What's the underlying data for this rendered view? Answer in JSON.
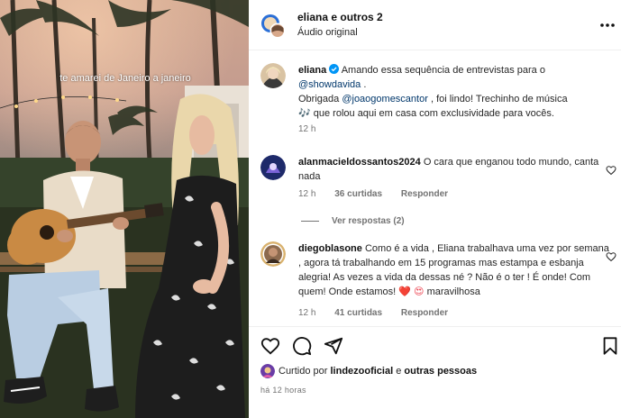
{
  "video": {
    "caption": "te amarei de Janeiro a janeiro"
  },
  "header": {
    "account": "eliana e outros 2",
    "audio": "Áudio original",
    "more_icon": "more-horizontal-icon"
  },
  "post": {
    "username": "eliana",
    "text_1": "Amando essa sequência de entrevistas para o",
    "mention_1": "@showdavida",
    "text_2": ".",
    "text_3": "Obrigada",
    "mention_2": "@joaogomescantor",
    "text_4": ", foi lindo! Trechinho de música",
    "text_5": "que rolou aqui em casa com exclusividade para vocês.",
    "music_emoji": "🎶",
    "time": "12 h"
  },
  "comments": [
    {
      "username": "alanmacieldossantos2024",
      "text": "O cara que enganou todo mundo, canta nada",
      "time": "12 h",
      "likes": "36 curtidas",
      "reply": "Responder"
    },
    {
      "username": "diegoblasone",
      "text": "Como é a vida , Eliana trabalhava uma vez por semana , agora tá trabalhando em 15 programas mas estampa e esbanja alegria! As vezes a vida da dessas né ? Não é o ter ! É onde! Com quem! Onde estamos!",
      "emoji": "❤️ 😍",
      "tail": "maravilhosa",
      "time": "12 h",
      "likes": "41 curtidas",
      "reply": "Responder"
    }
  ],
  "view_replies": "Ver respostas (2)",
  "likes_line": {
    "prefix": "Curtido por",
    "user": "lindezooficial",
    "middle": "e",
    "others": "outras pessoas"
  },
  "posted": "há 12 horas",
  "colors": {
    "verified": "#0095f6",
    "heart_red": "#ed4956",
    "link": "#00376b",
    "meta": "#737373"
  }
}
